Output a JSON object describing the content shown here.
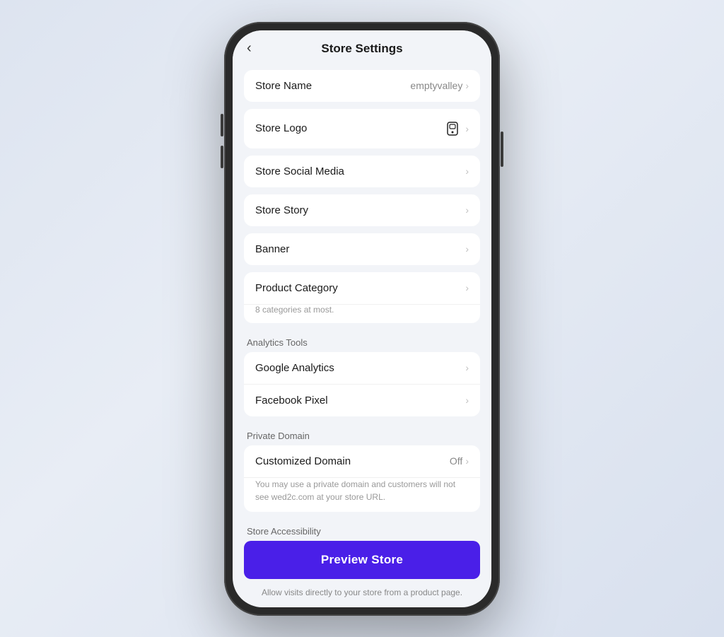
{
  "header": {
    "back_label": "‹",
    "title": "Store Settings"
  },
  "settings": {
    "rows": [
      {
        "id": "store-name",
        "label": "Store Name",
        "value": "emptyvalley",
        "has_chevron": true,
        "has_logo": false
      },
      {
        "id": "store-logo",
        "label": "Store Logo",
        "value": "",
        "has_chevron": true,
        "has_logo": true
      },
      {
        "id": "store-social-media",
        "label": "Store Social Media",
        "value": "",
        "has_chevron": true,
        "has_logo": false
      },
      {
        "id": "store-story",
        "label": "Store Story",
        "value": "",
        "has_chevron": true,
        "has_logo": false
      },
      {
        "id": "banner",
        "label": "Banner",
        "value": "",
        "has_chevron": true,
        "has_logo": false
      }
    ],
    "product_category": {
      "label": "Product Category",
      "sub_text": "8 categories at most.",
      "has_chevron": true
    },
    "analytics_section": "Analytics Tools",
    "analytics_rows": [
      {
        "id": "google-analytics",
        "label": "Google Analytics",
        "has_chevron": true
      },
      {
        "id": "facebook-pixel",
        "label": "Facebook Pixel",
        "has_chevron": true
      }
    ],
    "domain_section": "Private Domain",
    "domain": {
      "label": "Customized Domain",
      "value": "Off",
      "desc": "You may use a private domain and customers will not see wed2c.com at your store URL.",
      "has_chevron": true
    },
    "accessibility_section": "Store Accessibility",
    "preview_btn": "Preview Store",
    "accessibility_desc": "Allow visits directly to your store from a product page."
  },
  "chevron": "›"
}
